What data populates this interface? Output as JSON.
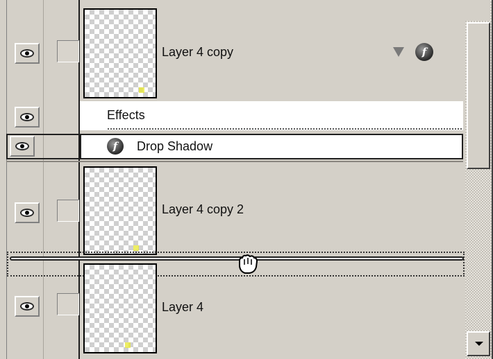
{
  "panel": {
    "layers": [
      {
        "name": "Layer 4 copy",
        "has_effects": true
      },
      {
        "name": "Layer 4 copy 2",
        "has_effects": false
      },
      {
        "name": "Layer 4",
        "has_effects": false
      }
    ],
    "effects": {
      "header_label": "Effects",
      "items": [
        {
          "label": "Drop Shadow"
        }
      ]
    },
    "fx_glyph": "f",
    "icons": {
      "visibility": "eye-icon",
      "link": "link-slot",
      "effects": "fx-icon",
      "expand": "triangle-down-icon",
      "drag_cursor": "grab-hand-icon"
    }
  },
  "scrollbar": {
    "down_arrow": "arrow-down-icon"
  }
}
